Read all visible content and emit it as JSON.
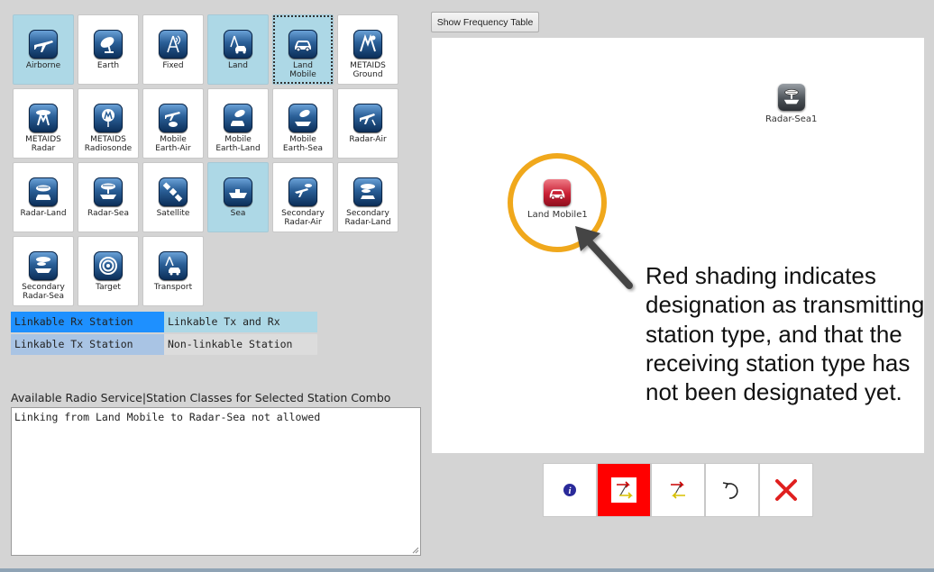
{
  "palette": [
    {
      "label": "Airborne",
      "icon": "plane-icon",
      "selected": true
    },
    {
      "label": "Earth",
      "icon": "satellite-dish-icon",
      "selected": false
    },
    {
      "label": "Fixed",
      "icon": "antenna-icon",
      "selected": false
    },
    {
      "label": "Land",
      "icon": "antenna-car-icon",
      "selected": true
    },
    {
      "label": "Land\nMobile",
      "icon": "car-icon",
      "selected": true,
      "focused": true
    },
    {
      "label": "METAIDS\nGround",
      "icon": "metaids-ground-icon",
      "selected": false
    },
    {
      "label": "METAIDS\nRadar",
      "icon": "metaids-radar-icon",
      "selected": false
    },
    {
      "label": "METAIDS\nRadiosonde",
      "icon": "radiosonde-icon",
      "selected": false
    },
    {
      "label": "Mobile\nEarth-Air",
      "icon": "plane-dish-icon",
      "selected": false
    },
    {
      "label": "Mobile\nEarth-Land",
      "icon": "car-dish-icon",
      "selected": false
    },
    {
      "label": "Mobile\nEarth-Sea",
      "icon": "ship-dish-icon",
      "selected": false
    },
    {
      "label": "Radar-Air",
      "icon": "radar-plane-icon",
      "selected": false
    },
    {
      "label": "Radar-Land",
      "icon": "radar-land-icon",
      "selected": false
    },
    {
      "label": "Radar-Sea",
      "icon": "radar-ship-icon",
      "selected": false
    },
    {
      "label": "Satellite",
      "icon": "satellite-icon",
      "selected": false
    },
    {
      "label": "Sea",
      "icon": "ship-icon",
      "selected": true
    },
    {
      "label": "Secondary\nRadar-Air",
      "icon": "secondary-radar-air-icon",
      "selected": false
    },
    {
      "label": "Secondary\nRadar-Land",
      "icon": "secondary-radar-land-icon",
      "selected": false
    },
    {
      "label": "Secondary\nRadar-Sea",
      "icon": "secondary-radar-sea-icon",
      "selected": false
    },
    {
      "label": "Target",
      "icon": "target-icon",
      "selected": false
    },
    {
      "label": "Transport",
      "icon": "transport-icon",
      "selected": false
    }
  ],
  "legend": {
    "rx": {
      "label": "Linkable Rx Station",
      "color": "#1e90ff"
    },
    "txrx": {
      "label": "Linkable Tx and Rx",
      "color": "#add8e6"
    },
    "tx": {
      "label": "Linkable Tx Station",
      "color": "#a9c4e4"
    },
    "none": {
      "label": "Non-linkable Station",
      "color": "#dcdcdc"
    }
  },
  "services": {
    "heading": "Available Radio Service|Station Classes for Selected Station Combo",
    "text": "Linking from Land Mobile to Radar-Sea not allowed"
  },
  "frequency_button": "Show Frequency Table",
  "canvas": {
    "nodes": [
      {
        "label": "Radar-Sea1",
        "icon": "radar-ship-icon",
        "state": "default"
      },
      {
        "label": "Land Mobile1",
        "icon": "car-icon",
        "state": "transmitting",
        "color": "#c81e33"
      }
    ]
  },
  "callout": {
    "text": "Red shading indicates designation as transmitting station type, and that the receiving station type has not been designated yet.",
    "circle_color": "#f0a81c"
  },
  "toolbar": [
    {
      "name": "info",
      "icon": "info-icon"
    },
    {
      "name": "transmit",
      "icon": "transmit-link-icon",
      "active": true,
      "color": "#ff0000"
    },
    {
      "name": "bidirectional",
      "icon": "bidirectional-link-icon"
    },
    {
      "name": "undo",
      "icon": "undo-icon"
    },
    {
      "name": "delete",
      "icon": "close-icon",
      "color": "#e0201f"
    }
  ]
}
